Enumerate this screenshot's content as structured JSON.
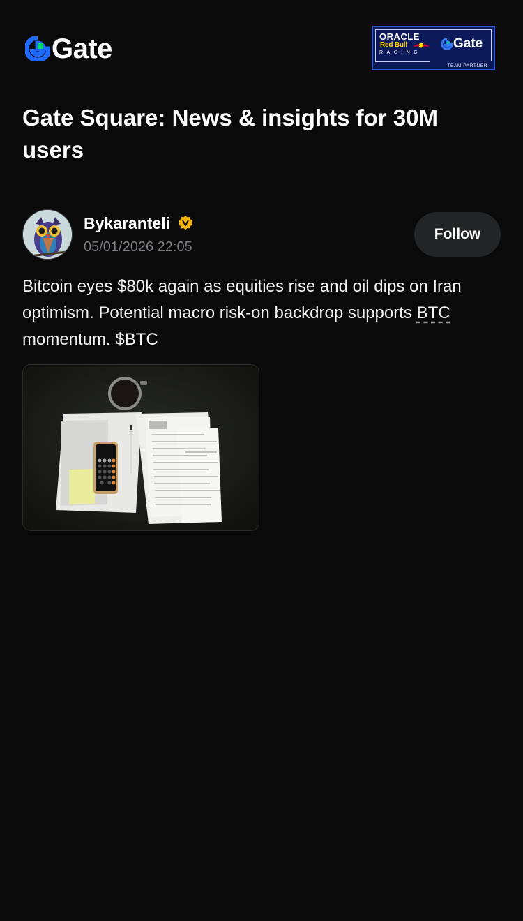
{
  "header": {
    "logo_text": "Gate",
    "partner_badge": {
      "oracle": "ORACLE",
      "redbull": "Red Bull",
      "racing": "RACING",
      "gate": "Gate",
      "team_partner": "TEAM PARTNER"
    }
  },
  "page_title": "Gate Square: News & insights for 30M users",
  "post": {
    "author": "Bykaranteli",
    "timestamp": "05/01/2026 22:05",
    "follow_label": "Follow",
    "text_before_link": "Bitcoin eyes $80k again as equities rise and oil dips on Iran optimism. Potential macro risk-on backdrop supports ",
    "ticker_link": "BTC",
    "text_after_link": " momentum. $BTC"
  },
  "colors": {
    "background": "#0a0a0b",
    "brand_blue": "#1f6bff",
    "brand_green": "#00d278",
    "verified_gold": "#f5b40a",
    "follow_bg": "#232425",
    "muted_text": "#7a7a7f"
  },
  "icons": {
    "logo": "gate-logo-icon",
    "verified": "verified-badge-icon"
  }
}
